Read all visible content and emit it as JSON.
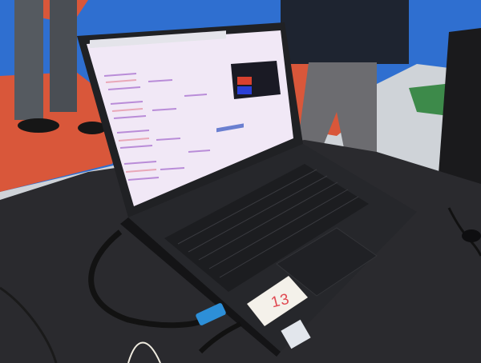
{
  "photo": {
    "sticker_number": "13"
  },
  "colors": {
    "floor_red": "#d9573a",
    "floor_blue": "#2f6fd0",
    "table_cloth": "#2a2a2e",
    "laptop_body": "#26272b",
    "screen_bg": "#f1e8f6",
    "usb_blue": "#2d8fd8",
    "sticker": "#f4f1ea"
  }
}
